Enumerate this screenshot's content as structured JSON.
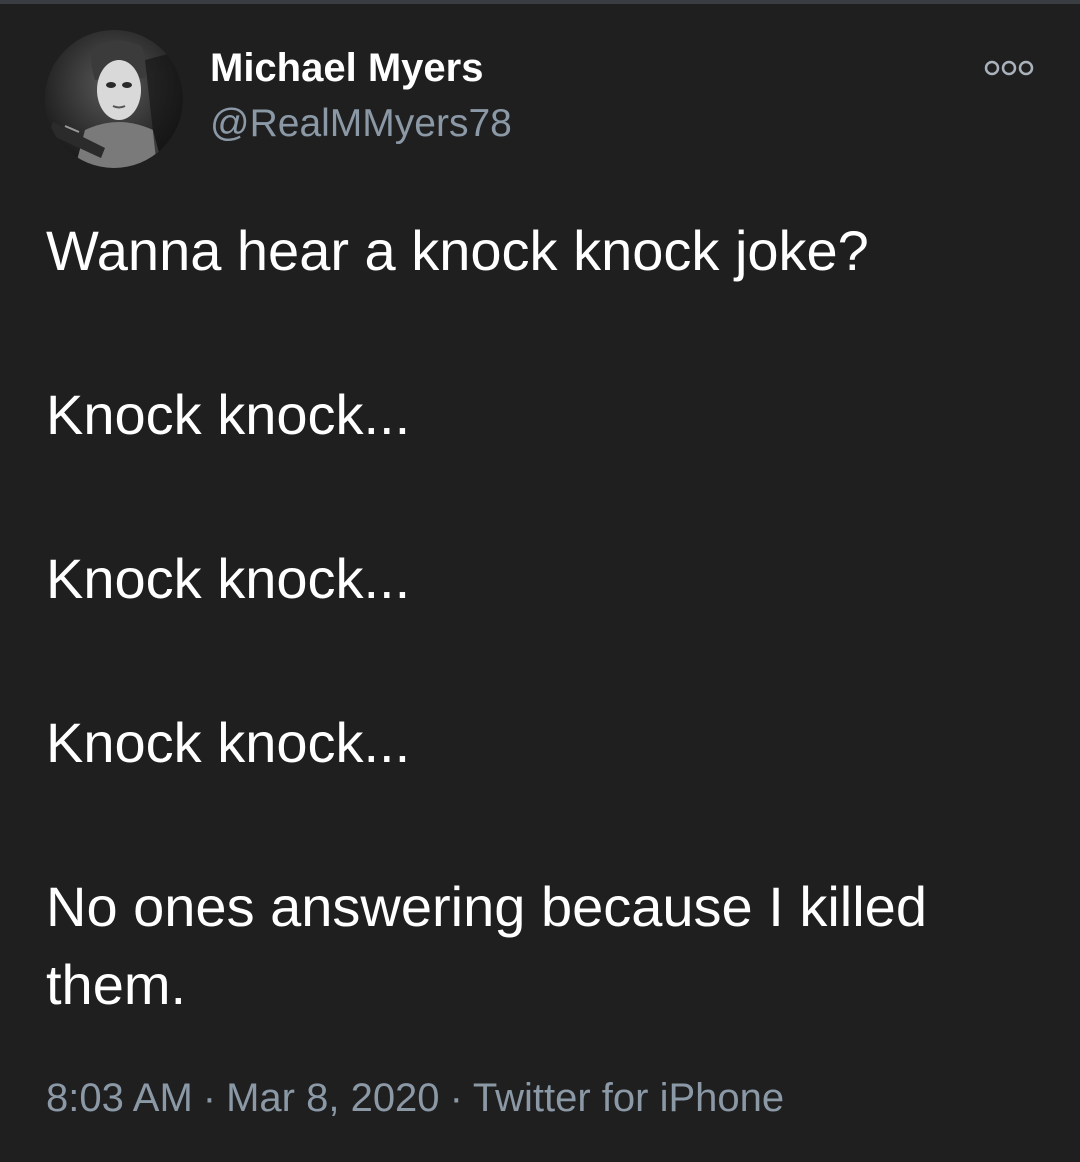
{
  "tweet": {
    "display_name": "Michael Myers",
    "handle": "@RealMMyers78",
    "more_icon": "more-horizontal-icon",
    "lines": [
      "Wanna hear a knock knock joke?",
      "Knock knock...",
      "Knock knock...",
      "Knock knock...",
      "No ones answering because I killed",
      "them."
    ],
    "time": "8:03 AM",
    "separator": "·",
    "date": "Mar 8, 2020",
    "source": "Twitter for iPhone"
  },
  "colors": {
    "background": "#1f1f20",
    "text": "#ffffff",
    "secondary_text": "#8b98a5"
  }
}
